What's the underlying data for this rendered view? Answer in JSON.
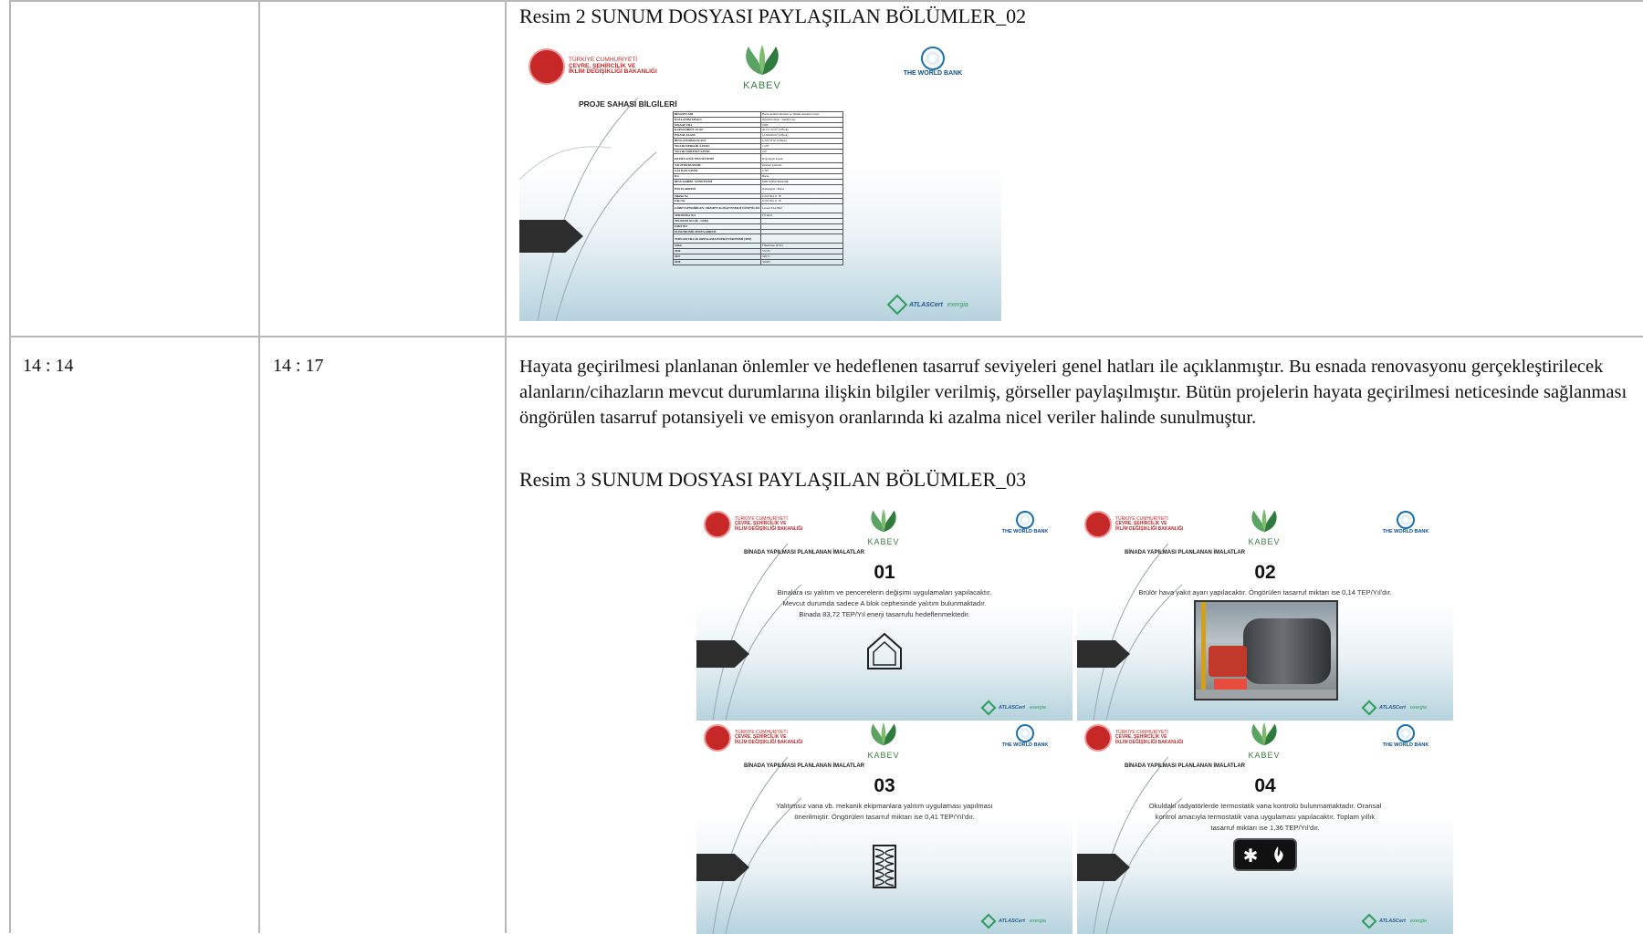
{
  "row1": {
    "caption": "Resim 2 SUNUM DOSYASI PAYLAŞILAN BÖLÜMLER_02"
  },
  "row2": {
    "start_time": "14 : 14",
    "end_time": "14 : 17",
    "paragraph": "Hayata geçirilmesi planlanan önlemler ve hedeflenen tasarruf seviyeleri genel hatları ile açıklanmıştır. Bu esnada renovasyonu gerçekleştirilecek alanların/cihazların mevcut durumlarına ilişkin bilgiler verilmiş, görseller paylaşılmıştır. Bütün projelerin hayata geçirilmesi neticesinde sağlanması öngörülen tasarruf potansiyeli ve emisyon oranlarında ki azalma nicel veriler halinde sunulmuştur.",
    "caption": "Resim 3 SUNUM DOSYASI PAYLAŞILAN BÖLÜMLER_03"
  },
  "branding": {
    "ministry_line1": "TÜRKİYE CUMHURİYETİ",
    "ministry_line2": "ÇEVRE, ŞEHİRCİLİK VE",
    "ministry_line3": "İKLİM DEĞİŞİKLİĞİ BAKANLIĞI",
    "kabev": "KABEV",
    "world_bank": "THE WORLD BANK",
    "atlascert": "ATLASCert",
    "exergia": "exergia"
  },
  "slide_info": {
    "title": "PROJE SAHASI BİLGİLERİ",
    "rows": [
      {
        "k": "BİNANIN ADI",
        "v": "Bursa Atatürk Mesleki ve Teknik Anadolu Lisesi"
      },
      {
        "k": "KULLANIM AMACI",
        "v": "Öğretim binası / Teknik Lise"
      },
      {
        "k": "İNŞAAT YILI",
        "v": "1980"
      },
      {
        "k": "KAPALI BRÜT ALAN",
        "v": "40.271,39 m² (6 Blok)"
      },
      {
        "k": "İNŞAAT ALANI",
        "v": "12.920,89 m² (6 Blok)"
      },
      {
        "k": "BİNA OTURMA ALANI",
        "v": "6.302,79 m² (6 Blok)"
      },
      {
        "k": "YILLIK DERSLİK SAYISI",
        "v": "1.278"
      },
      {
        "k": "YILLIK ÖĞRENCİ SAYISI",
        "v": "160"
      },
      {
        "k": "ISITMA SOĞUTMA SİSTEMİ",
        "v": "Doğalgazlı Kazan",
        "tall": true
      },
      {
        "k": "YALITIM DURUMU",
        "v": "Kısmen yalıtımlı"
      },
      {
        "k": "ÇALIŞAN SAYISI",
        "v": "2.397"
      },
      {
        "k": "İLİ",
        "v": "Bursa"
      },
      {
        "k": "BİNA SAHİBİ / YÖNETİCİSİ",
        "v": "Milli Eğitim Bakanlığı"
      },
      {
        "k": "POSTA ADRESİ",
        "v": "Osmangazi / Bursa",
        "tall": true
      },
      {
        "k": "Telefon No",
        "v": "0 224 364 11 18"
      },
      {
        "k": "Faks No",
        "v": "0 224 364 11 18"
      },
      {
        "k": "GÖREVLENDİRİLEN / HİZMET ALINAN ENERJİ YÖNETİCİSİ",
        "v": "Levent YALINIZ",
        "tall": true
      },
      {
        "k": "SERTİFİKA NO",
        "v": "EY-0025"
      },
      {
        "k": "TELEFON NO (İŞ - GSM)",
        "v": ""
      },
      {
        "k": "FAKS NO",
        "v": ""
      },
      {
        "k": "ELEKTRONİK POSTA ADRESİ",
        "v": ""
      },
      {
        "k": "TOPLAM YILLIK ORTALAMA ENERJİ TÜKETİMİ (TEP)",
        "v": "",
        "tall": true
      },
      {
        "k": "Yıllar",
        "v": "Tüketimler (TEP)"
      },
      {
        "k": "2016",
        "v": "572,35"
      },
      {
        "k": "2017",
        "v": "548,71"
      },
      {
        "k": "2018",
        "v": "520,83"
      }
    ]
  },
  "measures": [
    {
      "section_title": "BİNADA YAPILMASI PLANLANAN İMALATLAR",
      "number": "01",
      "line1": "Binalara ısı yalıtım ve pencerelerin değişimi uygulamaları yapılacaktır.",
      "line2": "Mevcut durumda sadece A blok cephesinde yalıtım bulunmaktadır.",
      "line3": "Binada 83,72 TEP/Yıl enerji tasarrufu hedeflenmektedir.",
      "icon": "house-icon"
    },
    {
      "section_title": "BİNADA YAPILMASI PLANLANAN İMALATLAR",
      "number": "02",
      "line1": "Brülör hava yakıt ayarı yapılacaktır. Öngörülen tasarruf miktarı ise 0,14 TEP/Yıl'dır.",
      "line2": "",
      "line3": "",
      "icon": "boiler-photo"
    },
    {
      "section_title": "BİNADA YAPILMASI PLANLANAN İMALATLAR",
      "number": "03",
      "line1": "Yalıtımsız vana vb. mekanik ekipmanlara yalıtım uygulaması yapılması",
      "line2": "önerilmiştir. Öngörülen tasarruf miktarı ise 0,41 TEP/Yıl'dır.",
      "line3": "",
      "icon": "insulation-icon"
    },
    {
      "section_title": "BİNADA YAPILMASI PLANLANAN İMALATLAR",
      "number": "04",
      "line1": "Okuldaki radyatörlerde termostatik vana kontrolü bulunmamaktadır. Oransal",
      "line2": "kontrol amacıyla termostatik vana uygulaması yapılacaktır. Toplam yıllık",
      "line3": "tasarruf miktarı ise 1,36 TEP/Yıl'dır.",
      "icon": "thermostat-icon"
    }
  ]
}
